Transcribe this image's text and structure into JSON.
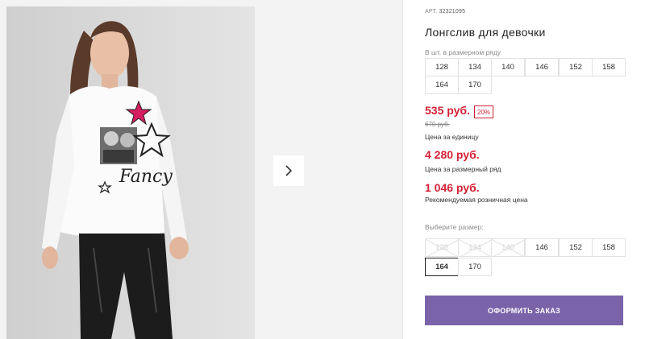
{
  "product": {
    "sku_label": "АРТ.",
    "sku_value": "32321095",
    "title": "Лонгслив для девочки"
  },
  "pack": {
    "label": "В шт. в размерном ряду",
    "sizes": [
      "128",
      "134",
      "140",
      "146",
      "152",
      "158",
      "164",
      "170"
    ]
  },
  "pricing": {
    "unit_price": "535 руб.",
    "discount": "20%",
    "old_price": "670 руб.",
    "unit_caption": "Цена за единицу",
    "row_price": "4 280 руб.",
    "row_caption": "Цена за размерный ряд",
    "retail_price": "1 046 руб.",
    "retail_caption": "Рекомендуемая розничная цена"
  },
  "size_select": {
    "label": "Выберите размер:",
    "sizes": [
      "128",
      "134",
      "140",
      "146",
      "152",
      "158",
      "164",
      "170"
    ],
    "unavailable": [
      "128",
      "134",
      "140"
    ],
    "selected": "164"
  },
  "gallery": {
    "next_icon": "chevron-right-icon",
    "print_text": "Fancy"
  },
  "order_button": "ОФОРМИТЬ ЗАКАЗ",
  "colors": {
    "price_red": "#d32035",
    "button_purple": "#7a63a8"
  }
}
